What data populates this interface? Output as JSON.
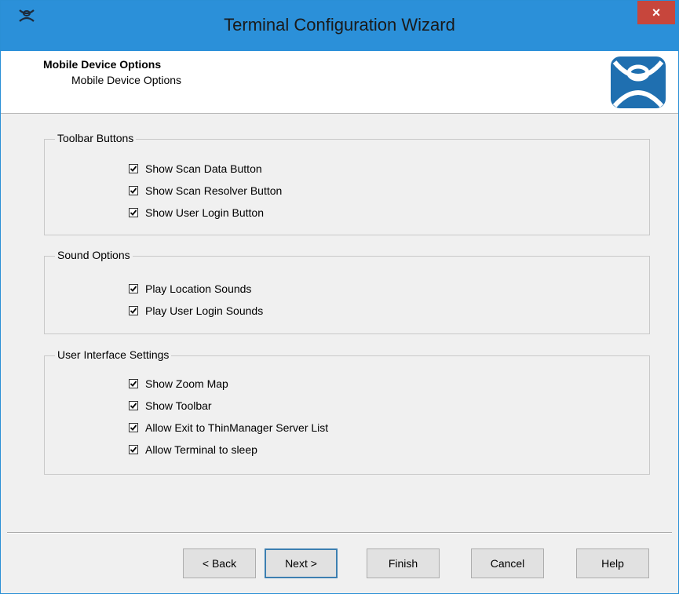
{
  "window": {
    "title": "Terminal Configuration Wizard",
    "close_glyph": "×",
    "app_icon": "thinmanager-logo-icon"
  },
  "header": {
    "title": "Mobile Device Options",
    "subtitle": "Mobile Device Options",
    "logo_icon": "thinmanager-logo-icon"
  },
  "groups": {
    "toolbar": {
      "legend": "Toolbar Buttons",
      "items": [
        {
          "label": "Show Scan Data Button",
          "checked": true
        },
        {
          "label": "Show Scan Resolver Button",
          "checked": true
        },
        {
          "label": "Show User Login Button",
          "checked": true
        }
      ]
    },
    "sound": {
      "legend": "Sound Options",
      "items": [
        {
          "label": "Play Location Sounds",
          "checked": true
        },
        {
          "label": "Play User Login Sounds",
          "checked": true
        }
      ]
    },
    "ui": {
      "legend": "User Interface Settings",
      "items": [
        {
          "label": "Show Zoom Map",
          "checked": true
        },
        {
          "label": "Show Toolbar",
          "checked": true
        },
        {
          "label": "Allow Exit to ThinManager Server List",
          "checked": true
        },
        {
          "label": "Allow Terminal to sleep",
          "checked": true
        }
      ]
    }
  },
  "buttons": {
    "back": "< Back",
    "next": "Next >",
    "finish": "Finish",
    "cancel": "Cancel",
    "help": "Help"
  },
  "colors": {
    "titlebar": "#2b90d9",
    "close": "#c7463c",
    "dialog_bg": "#f0f0f0",
    "logo_blue": "#1f6fb0"
  }
}
